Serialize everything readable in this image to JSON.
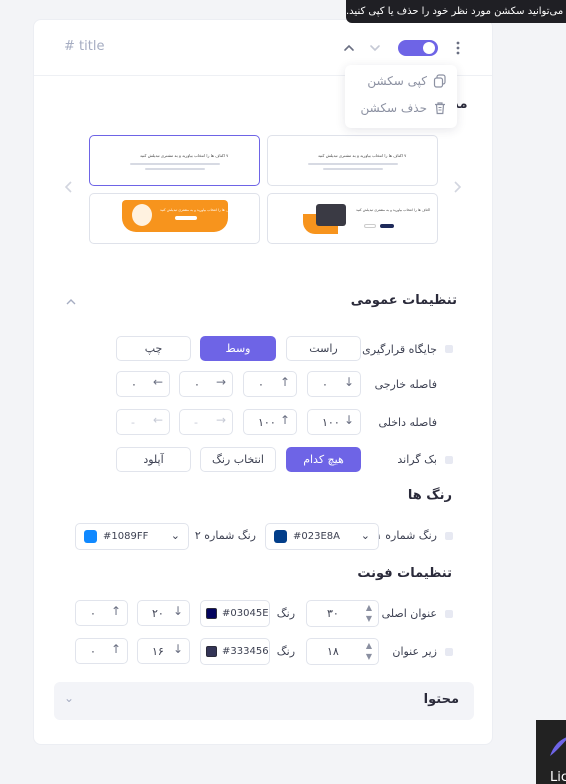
{
  "tooltip": {
    "text": "می‌توانید سکشن مورد نظر خود را حذف یا کپی کنید."
  },
  "header": {
    "title_placeholder": "# title",
    "toggle_on": true
  },
  "menu": {
    "copy_label": "کپی سکشن",
    "delete_label": "حذف سکشن"
  },
  "partial_label": "مد",
  "templates": [
    {
      "title": "۷ اکتاف ها را انتخاب بیاورید و به مشتری تبدیلش کنید"
    },
    {
      "title": "۷ اکتاف ها را انتخاب بیاورید و به مشتری تبدیلش کنید"
    },
    {
      "title": "اکتاف ها را انتخاب بیاورید و به مشتری تبدیلش کنید"
    },
    {
      "title": "اکتاف ها را انتخاب بیاورید و به مشتری تبدیلش کنید"
    }
  ],
  "general": {
    "title": "تنظیمات عمومی",
    "position": {
      "label": "جایگاه قرارگیری",
      "options": [
        "راست",
        "وسط",
        "چپ"
      ],
      "selected": "وسط"
    },
    "margin": {
      "label": "فاصله خارجی",
      "values": [
        "۰",
        "۰",
        "۰",
        "۰"
      ]
    },
    "padding": {
      "label": "فاصله داخلی",
      "values": [
        "۱۰۰",
        "۱۰۰",
        "-",
        "-"
      ]
    },
    "background": {
      "label": "بک گراند",
      "options": [
        "هیچ کدام",
        "انتخاب رنگ",
        "آپلود"
      ],
      "selected": "هیچ کدام"
    }
  },
  "colors": {
    "title": "رنگ ها",
    "color1": {
      "label": "رنگ شماره ۱",
      "hex": "#023E8A",
      "swatch": "#023E8A"
    },
    "color2": {
      "label": "رنگ شماره ۲",
      "hex": "#1089FF",
      "swatch": "#1089FF"
    }
  },
  "fonts": {
    "title": "تنظیمات فونت",
    "heading": {
      "label": "عنوان اصلی",
      "size": "۳۰",
      "color_label": "رنگ",
      "hex": "#03045E",
      "swatch": "#03045E",
      "weight": "۲۰",
      "extra": "۰"
    },
    "subheading": {
      "label": "زیر عنوان",
      "size": "۱۸",
      "color_label": "رنگ",
      "hex": "#333456",
      "swatch": "#333456",
      "weight": "۱۶",
      "extra": "۰"
    }
  },
  "content": {
    "title": "محتوا"
  },
  "corner": {
    "text": "Lic"
  },
  "accent": "#6e64e6"
}
